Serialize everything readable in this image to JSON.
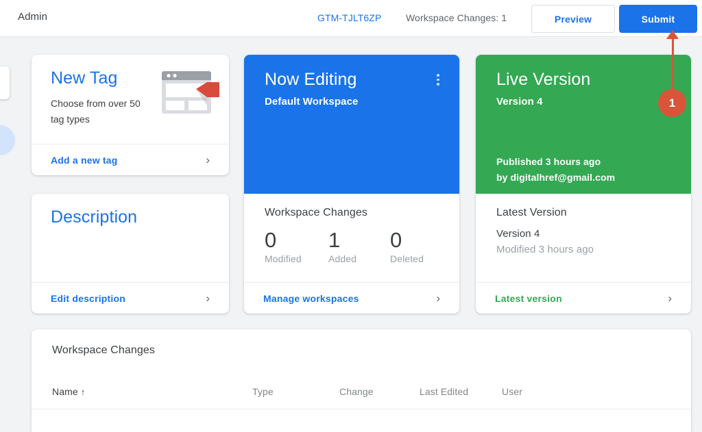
{
  "header": {
    "title": "Admin",
    "container_id": "GTM-TJLT6ZP",
    "workspace_changes": "Workspace Changes: 1",
    "preview_label": "Preview",
    "submit_label": "Submit"
  },
  "new_tag_card": {
    "title": "New Tag",
    "subtitle": "Choose from over 50 tag types",
    "footer_label": "Add a new tag",
    "chevron": "›",
    "icon": "browser-tag-icon"
  },
  "description_card": {
    "title": "Description",
    "footer_label": "Edit description",
    "chevron": "›"
  },
  "now_editing_card": {
    "title": "Now Editing",
    "subtitle": "Default Workspace",
    "accent_color": "#1a73e8",
    "menu_icon": "kebab-menu-icon",
    "body_title": "Workspace Changes",
    "stats": [
      {
        "value": "0",
        "label": "Modified"
      },
      {
        "value": "1",
        "label": "Added"
      },
      {
        "value": "0",
        "label": "Deleted"
      }
    ],
    "footer_label": "Manage workspaces",
    "chevron": "›"
  },
  "live_version_card": {
    "title": "Live Version",
    "subtitle": "Version 4",
    "accent_color": "#34a853",
    "published": "Published 3 hours ago",
    "published_by": "by digitalhref@gmail.com",
    "latest_title": "Latest Version",
    "latest_version": "Version 4",
    "latest_modified": "Modified 3 hours ago",
    "footer_label": "Latest version",
    "chevron": "›"
  },
  "workspace_changes_table": {
    "title": "Workspace Changes",
    "columns": [
      {
        "label": "Name",
        "sort": "↑"
      },
      {
        "label": "Type"
      },
      {
        "label": "Change"
      },
      {
        "label": "Last Edited"
      },
      {
        "label": "User"
      }
    ],
    "rows": []
  },
  "annotation": {
    "badge_number": "1",
    "color": "#d9553a",
    "points_to": "Submit"
  }
}
